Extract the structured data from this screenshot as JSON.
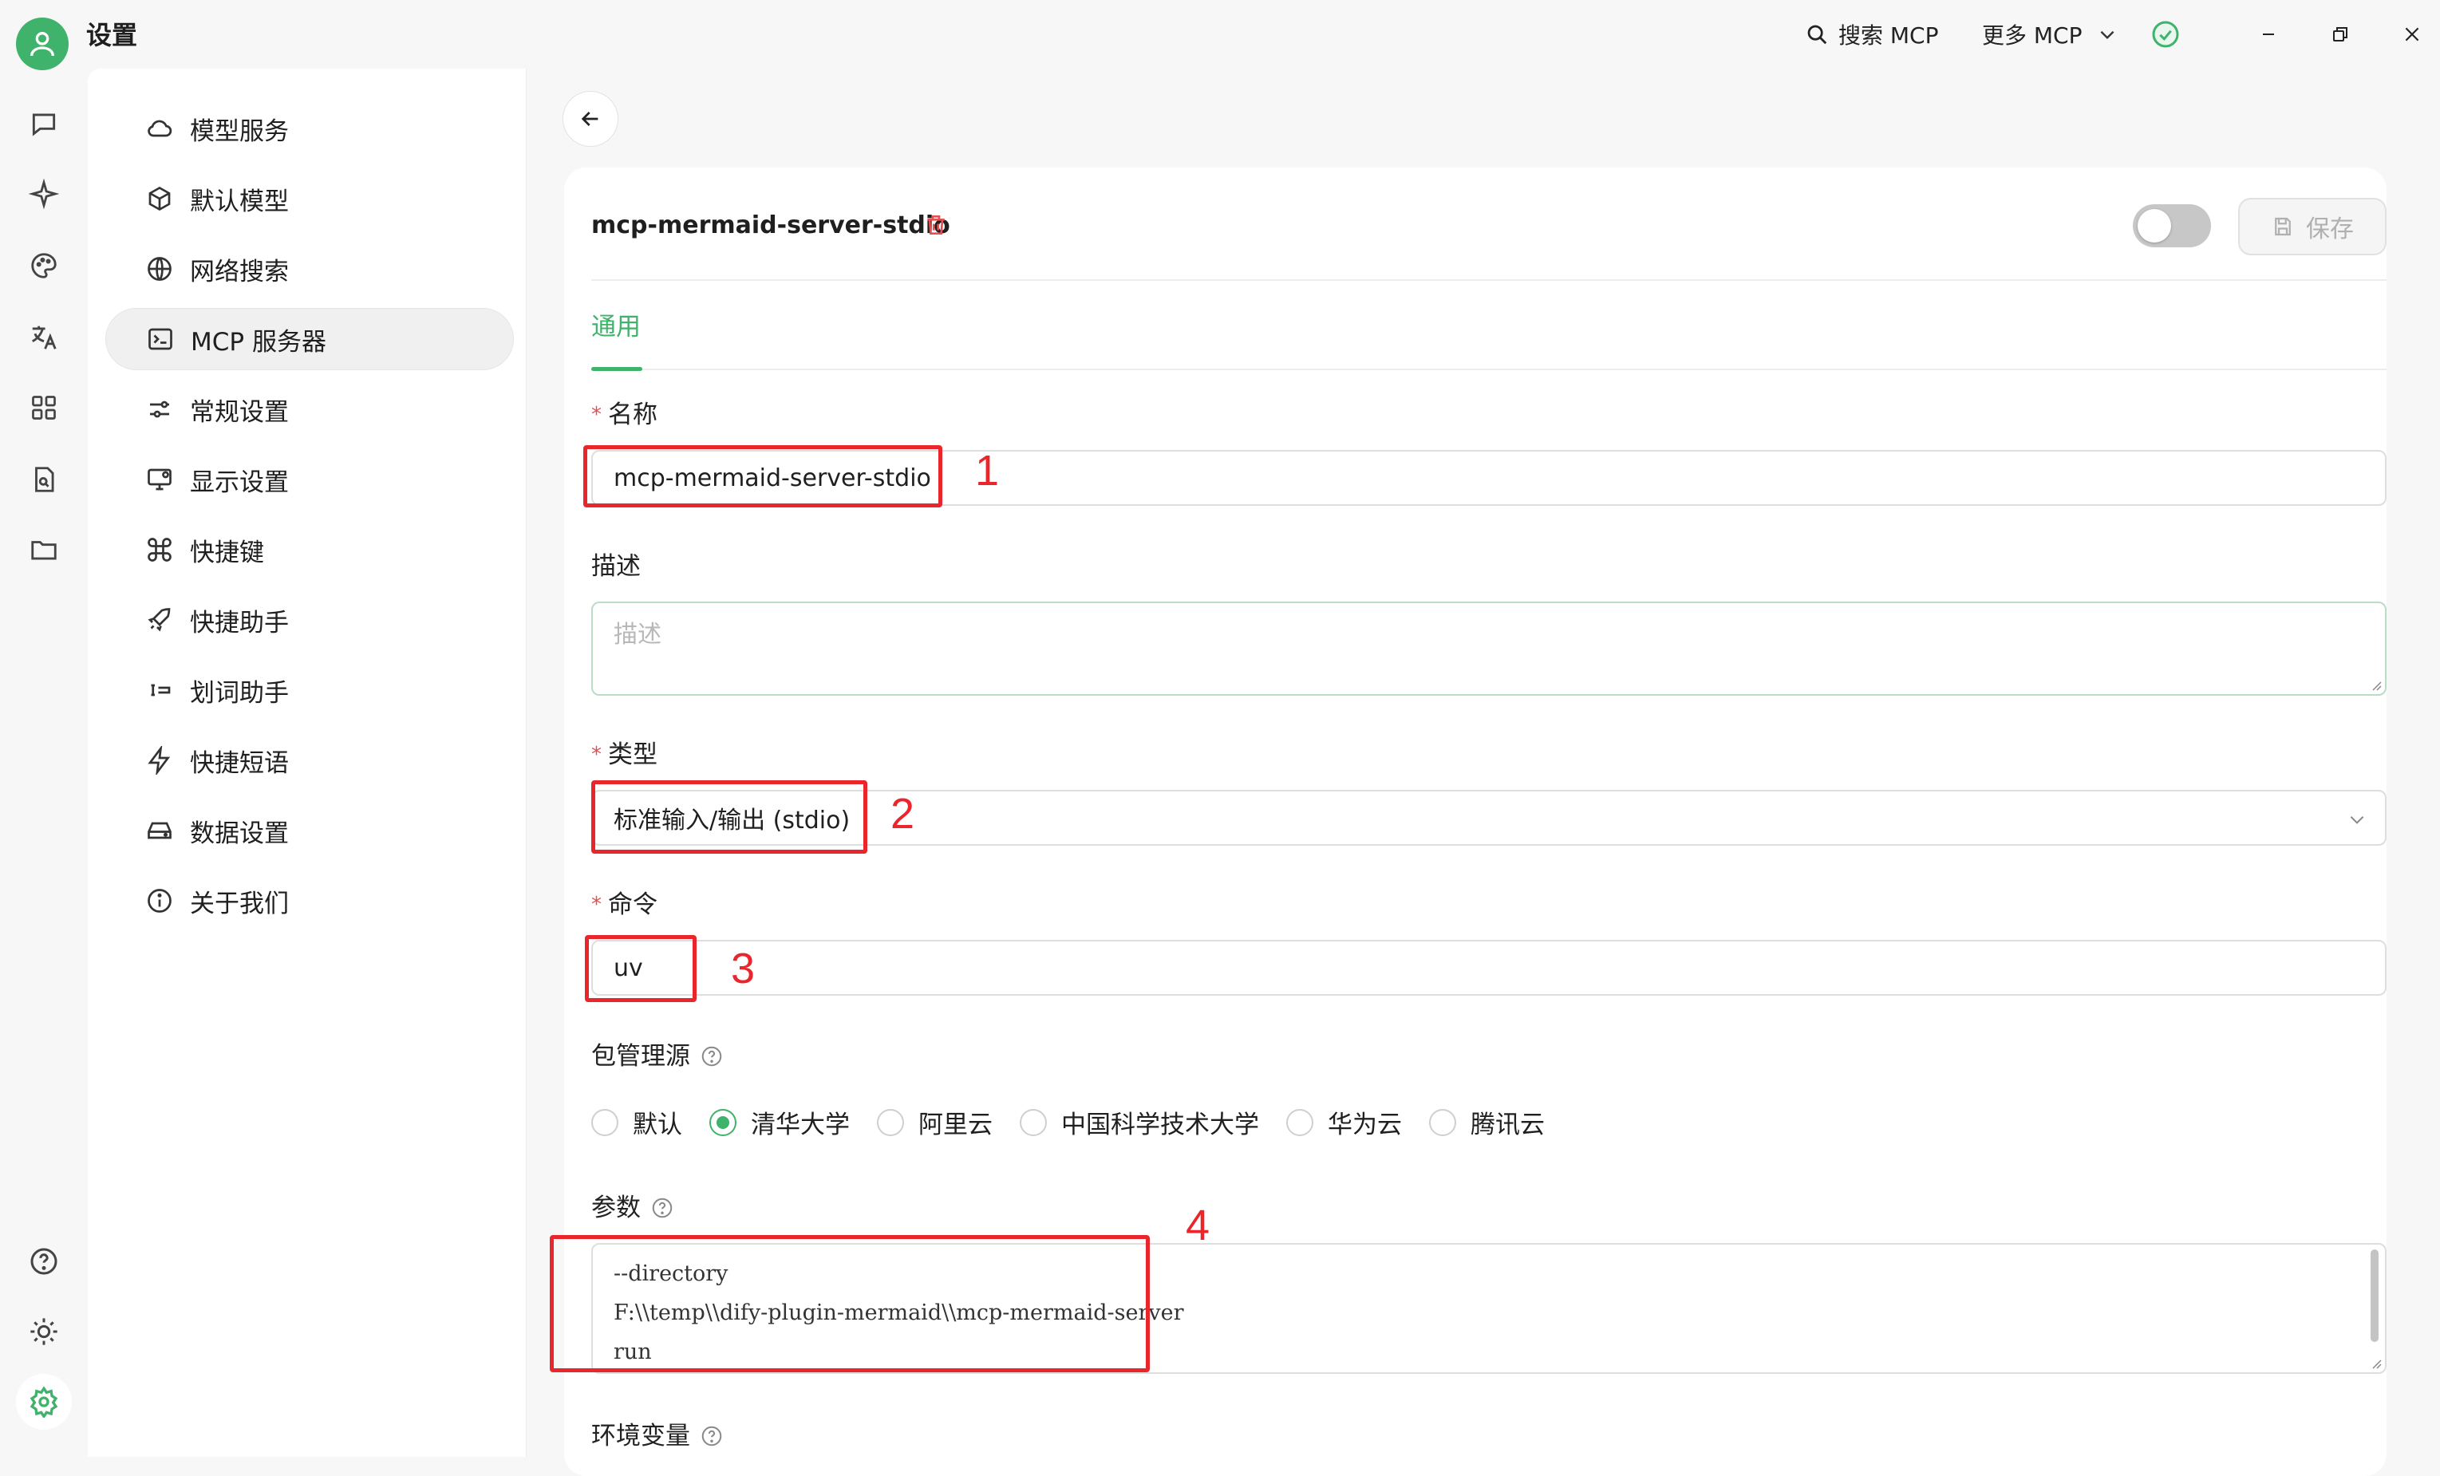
{
  "titlebar": {
    "title": "设置",
    "search_label": "搜索 MCP",
    "more_label": "更多 MCP",
    "status_color": "#3fb26b"
  },
  "rail": {
    "icons": [
      "chat-icon",
      "sparkle-icon",
      "palette-icon",
      "translate-icon",
      "grid-icon",
      "file-search-icon",
      "folder-icon",
      "help-icon",
      "theme-icon",
      "settings-icon"
    ]
  },
  "nav": {
    "items": [
      {
        "label": "模型服务",
        "icon": "cloud-icon"
      },
      {
        "label": "默认模型",
        "icon": "cube-icon"
      },
      {
        "label": "网络搜索",
        "icon": "globe-icon"
      },
      {
        "label": "MCP 服务器",
        "icon": "terminal-icon",
        "active": true
      },
      {
        "label": "常规设置",
        "icon": "sliders-icon"
      },
      {
        "label": "显示设置",
        "icon": "monitor-icon"
      },
      {
        "label": "快捷键",
        "icon": "command-icon"
      },
      {
        "label": "快捷助手",
        "icon": "rocket-icon"
      },
      {
        "label": "划词助手",
        "icon": "text-cursor-icon"
      },
      {
        "label": "快捷短语",
        "icon": "zap-icon"
      },
      {
        "label": "数据设置",
        "icon": "drive-icon"
      },
      {
        "label": "关于我们",
        "icon": "info-icon"
      }
    ]
  },
  "server": {
    "name": "mcp-mermaid-server-stdio",
    "save_label": "保存",
    "enabled": false,
    "tab": "通用",
    "fields": {
      "name_label": "名称",
      "name_value": "mcp-mermaid-server-stdio",
      "desc_label": "描述",
      "desc_placeholder": "描述",
      "type_label": "类型",
      "type_value": "标准输入/输出 (stdio)",
      "command_label": "命令",
      "command_value": "uv",
      "registry_label": "包管理源",
      "registry_options": [
        "默认",
        "清华大学",
        "阿里云",
        "中国科学技术大学",
        "华为云",
        "腾讯云"
      ],
      "registry_selected": "清华大学",
      "args_label": "参数",
      "args_lines": [
        "--directory",
        "F:\\\\temp\\\\dify-plugin-mermaid\\\\mcp-mermaid-server",
        "run"
      ],
      "env_label": "环境变量"
    }
  },
  "annotations": [
    "1",
    "2",
    "3",
    "4"
  ],
  "colors": {
    "accent": "#3fb26b",
    "annotation": "#e8262c",
    "danger": "#e25050"
  }
}
